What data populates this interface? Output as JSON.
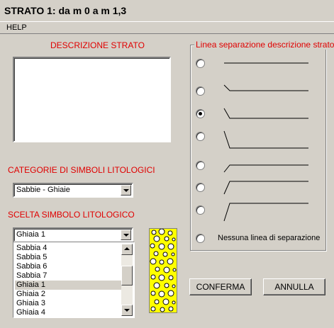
{
  "window": {
    "title": "STRATO 1: da m 0 a m 1,3"
  },
  "menu": {
    "items": [
      "HELP"
    ]
  },
  "description": {
    "label": "DESCRIZIONE STRATO",
    "value": ""
  },
  "categories": {
    "label": "CATEGORIE DI SIMBOLI LITOLOGICI",
    "selected": "Sabbie - Ghiaie"
  },
  "symbol": {
    "label": "SCELTA SIMBOLO LITOLOGICO",
    "selected": "Ghiaia 1",
    "list": [
      "Sabbia 4",
      "Sabbia 5",
      "Sabbia 6",
      "Sabbia 7",
      "Ghiaia 1",
      "Ghiaia 2",
      "Ghiaia 3",
      "Ghiaia 4"
    ],
    "selected_index": 4
  },
  "separation": {
    "label": "Linea separazione descrizione strato",
    "selected_index": 2,
    "none_label": "Nessuna linea di separazione"
  },
  "buttons": {
    "confirm": "CONFERMA",
    "cancel": "ANNULLA"
  }
}
